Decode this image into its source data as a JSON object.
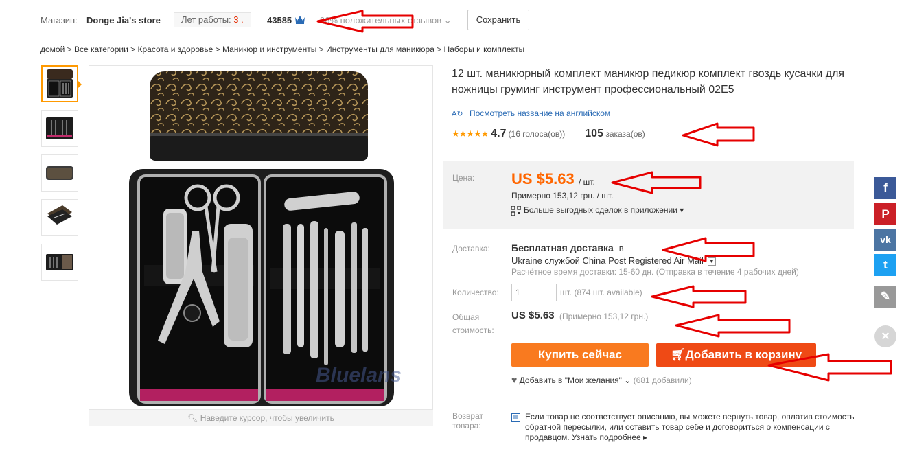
{
  "store_bar": {
    "label": "Магазин:",
    "name": "Donge Jia's store",
    "years_label": "Лет работы:",
    "years_value": "3 .",
    "followers": "43585",
    "feedback_prefix": "96%",
    "feedback_label": "положительных отзывов",
    "save_label": "Сохранить"
  },
  "breadcrumb": "домой > Все категории > Красота и здоровье > Маникюр и инструменты > Инструменты для маникюра > Наборы и комплекты",
  "gallery": {
    "zoom_hint": "Наведите курсор, чтобы увеличить",
    "watermark": "Bluelans"
  },
  "product": {
    "title": "12 шт. маникюрный комплект маникюр педикюр комплект гвоздь кусачки для ножницы груминг инструмент профессиональный 02E5",
    "translate_link": "Посмотреть название на английском",
    "rating_score": "4.7",
    "votes": "(16 голоса(ов))",
    "orders_count": "105",
    "orders_label": "заказа(ов)"
  },
  "price": {
    "label": "Цена:",
    "value": "US $5.63",
    "unit": "/ шт.",
    "approx": "Примерно 153,12 грн. / шт.",
    "app_deals": "Больше выгодных сделок в приложении"
  },
  "shipping": {
    "label": "Доставка:",
    "title": "Бесплатная доставка",
    "title_suffix": "в",
    "line": "Ukraine службой China Post Registered Air Mail",
    "time": "Расчётное время доставки: 15-60 дн. (Отправка в течение 4 рабочих дней)"
  },
  "quantity": {
    "label": "Количество:",
    "value": "1",
    "note": "шт. (874 шт. available)"
  },
  "total": {
    "label_line1": "Общая",
    "label_line2": "стоимость:",
    "value": "US $5.63",
    "approx": "(Примерно 153,12 грн.)"
  },
  "actions": {
    "buy_label": "Купить сейчас",
    "cart_label": "Добавить в корзину",
    "wishlist_label": "Добавить в \"Мои желания\"",
    "wishlist_count": "(681 добавили)"
  },
  "returns": {
    "label_line1": "Возврат",
    "label_line2": "товара:",
    "text": "Если товар не соответствует описанию, вы можете вернуть товар, оплатив стоимость обратной пересылки, или оставить товар себе и договориться о компенсации с продавцом.",
    "link": "Узнать подробнее"
  },
  "social": [
    {
      "name": "facebook",
      "glyph": "f",
      "color": "#3b5998"
    },
    {
      "name": "pinterest",
      "glyph": "P",
      "color": "#cb2027"
    },
    {
      "name": "vk",
      "glyph": "vk",
      "color": "#4c75a3"
    },
    {
      "name": "twitter",
      "glyph": "t",
      "color": "#1da1f2"
    },
    {
      "name": "edit",
      "glyph": "✎",
      "color": "#999999"
    }
  ],
  "colors": {
    "price_orange": "#ff6600",
    "buy_button": "#f97a1f",
    "cart_button": "#ef4a15",
    "annotation_red": "#e60000",
    "link_blue": "#2a6bb5"
  }
}
